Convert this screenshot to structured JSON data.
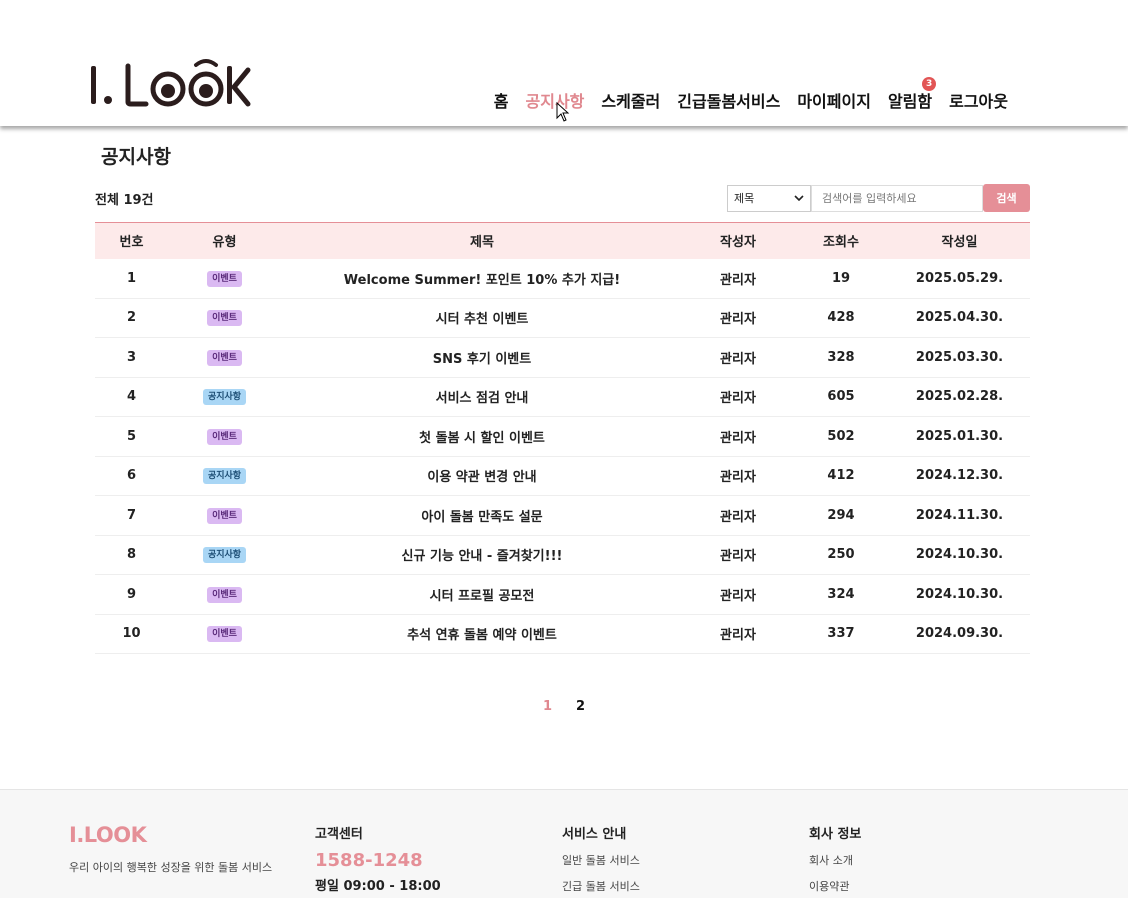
{
  "header": {
    "logo_text": "I.LOOK",
    "nav": [
      {
        "label": "홈",
        "active": false
      },
      {
        "label": "공지사항",
        "active": true
      },
      {
        "label": "스케줄러",
        "active": false
      },
      {
        "label": "긴급돌봄서비스",
        "active": false
      },
      {
        "label": "마이페이지",
        "active": false
      },
      {
        "label": "알림함",
        "active": false,
        "badge": "3"
      },
      {
        "label": "로그아웃",
        "active": false
      }
    ]
  },
  "main": {
    "title": "공지사항",
    "total": "전체 19건",
    "search": {
      "select_value": "제목",
      "placeholder": "검색어를 입력하세요",
      "button_label": "검색"
    },
    "table": {
      "headers": [
        "번호",
        "유형",
        "제목",
        "작성자",
        "조회수",
        "작성일"
      ],
      "rows": [
        {
          "no": "1",
          "type": "이벤트",
          "kind": "event",
          "title": "Welcome Summer! 포인트 10% 추가 지급!",
          "author": "관리자",
          "views": "19",
          "date": "2025.05.29."
        },
        {
          "no": "2",
          "type": "이벤트",
          "kind": "event",
          "title": "시터 추천 이벤트",
          "author": "관리자",
          "views": "428",
          "date": "2025.04.30."
        },
        {
          "no": "3",
          "type": "이벤트",
          "kind": "event",
          "title": "SNS 후기 이벤트",
          "author": "관리자",
          "views": "328",
          "date": "2025.03.30."
        },
        {
          "no": "4",
          "type": "공지사항",
          "kind": "notice",
          "title": "서비스 점검 안내",
          "author": "관리자",
          "views": "605",
          "date": "2025.02.28."
        },
        {
          "no": "5",
          "type": "이벤트",
          "kind": "event",
          "title": "첫 돌봄 시 할인 이벤트",
          "author": "관리자",
          "views": "502",
          "date": "2025.01.30."
        },
        {
          "no": "6",
          "type": "공지사항",
          "kind": "notice",
          "title": "이용 약관 변경 안내",
          "author": "관리자",
          "views": "412",
          "date": "2024.12.30."
        },
        {
          "no": "7",
          "type": "이벤트",
          "kind": "event",
          "title": "아이 돌봄 만족도 설문",
          "author": "관리자",
          "views": "294",
          "date": "2024.11.30."
        },
        {
          "no": "8",
          "type": "공지사항",
          "kind": "notice",
          "title": "신규 기능 안내 - 즐겨찾기!!!",
          "author": "관리자",
          "views": "250",
          "date": "2024.10.30."
        },
        {
          "no": "9",
          "type": "이벤트",
          "kind": "event",
          "title": "시터 프로필 공모전",
          "author": "관리자",
          "views": "324",
          "date": "2024.10.30."
        },
        {
          "no": "10",
          "type": "이벤트",
          "kind": "event",
          "title": "추석 연휴 돌봄 예약 이벤트",
          "author": "관리자",
          "views": "337",
          "date": "2024.09.30."
        }
      ]
    },
    "pagination": {
      "pages": [
        "1",
        "2"
      ],
      "current": "1"
    }
  },
  "footer": {
    "brand": "I.LOOK",
    "desc": "우리 아이의 행복한 성장을 위한 돌봄 서비스",
    "cs_title": "고객센터",
    "phone": "1588-1248",
    "hours": "평일 09:00 - 18:00",
    "service_title": "서비스 안내",
    "service_links": [
      "일반 돌봄 서비스",
      "긴급 돌봄 서비스"
    ],
    "company_title": "회사 정보",
    "company_links": [
      "회사 소개",
      "이용약관"
    ]
  },
  "colors": {
    "accent": "#e58f97",
    "header_row": "#fdeaea",
    "event_tag": "#dab9f2",
    "notice_tag": "#a9d6f5",
    "badge": "#e25555"
  }
}
